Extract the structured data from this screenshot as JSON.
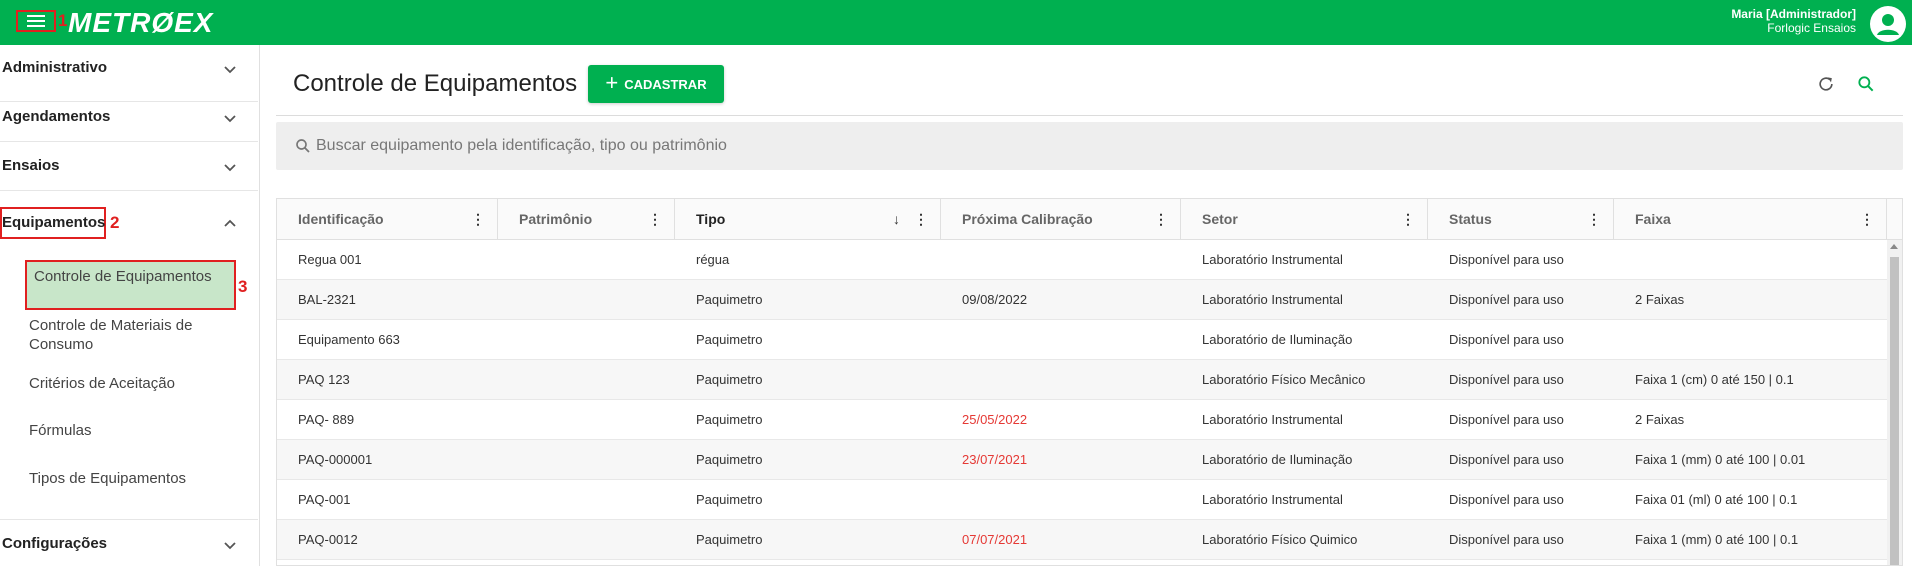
{
  "app": {
    "logo": "METRØEX",
    "user_name": "Maria [Administrador]",
    "user_company": "Forlogic Ensaios"
  },
  "markers": {
    "m1": "1",
    "m2": "2",
    "m3": "3"
  },
  "sidebar": {
    "sections": [
      {
        "label": "Administrativo"
      },
      {
        "label": "Agendamentos"
      },
      {
        "label": "Ensaios"
      },
      {
        "label": "Equipamentos"
      },
      {
        "label": "Configurações"
      }
    ],
    "sub_items": [
      {
        "label": "Controle de Equipamentos"
      },
      {
        "label": "Controle de Materiais de Consumo"
      },
      {
        "label": "Critérios de Aceitação"
      },
      {
        "label": "Fórmulas"
      },
      {
        "label": "Tipos de Equipamentos"
      }
    ]
  },
  "main": {
    "title": "Controle de Equipamentos",
    "add_button": "CADASTRAR",
    "search_placeholder": "Buscar equipamento pela identificação, tipo ou patrimônio"
  },
  "table": {
    "columns": [
      "Identificação",
      "Patrimônio",
      "Tipo",
      "Próxima Calibração",
      "Setor",
      "Status",
      "Faixa"
    ],
    "sort_column": "Tipo",
    "rows": [
      {
        "id": "Regua 001",
        "patrimonio": "",
        "tipo": "régua",
        "calibracao": "",
        "calibracao_overdue": false,
        "setor": "Laboratório Instrumental",
        "status": "Disponível para uso",
        "faixa": ""
      },
      {
        "id": "BAL-2321",
        "patrimonio": "",
        "tipo": "Paquimetro",
        "calibracao": "09/08/2022",
        "calibracao_overdue": false,
        "setor": "Laboratório Instrumental",
        "status": "Disponível para uso",
        "faixa": "2 Faixas"
      },
      {
        "id": "Equipamento 663",
        "patrimonio": "",
        "tipo": "Paquimetro",
        "calibracao": "",
        "calibracao_overdue": false,
        "setor": "Laboratório de Iluminação",
        "status": "Disponível para uso",
        "faixa": ""
      },
      {
        "id": "PAQ 123",
        "patrimonio": "",
        "tipo": "Paquimetro",
        "calibracao": "",
        "calibracao_overdue": false,
        "setor": "Laboratório Físico Mecânico",
        "status": "Disponível para uso",
        "faixa": "Faixa 1 (cm) 0 até 150 | 0.1"
      },
      {
        "id": "PAQ- 889",
        "patrimonio": "",
        "tipo": "Paquimetro",
        "calibracao": "25/05/2022",
        "calibracao_overdue": true,
        "setor": "Laboratório Instrumental",
        "status": "Disponível para uso",
        "faixa": "2 Faixas"
      },
      {
        "id": "PAQ-000001",
        "patrimonio": "",
        "tipo": "Paquimetro",
        "calibracao": "23/07/2021",
        "calibracao_overdue": true,
        "setor": "Laboratório de Iluminação",
        "status": "Disponível para uso",
        "faixa": "Faixa 1 (mm) 0 até 100 | 0.01"
      },
      {
        "id": "PAQ-001",
        "patrimonio": "",
        "tipo": "Paquimetro",
        "calibracao": "",
        "calibracao_overdue": false,
        "setor": "Laboratório Instrumental",
        "status": "Disponível para uso",
        "faixa": "Faixa 01 (ml) 0 até 100 | 0.1"
      },
      {
        "id": "PAQ-0012",
        "patrimonio": "",
        "tipo": "Paquimetro",
        "calibracao": "07/07/2021",
        "calibracao_overdue": true,
        "setor": "Laboratório Físico Quimico",
        "status": "Disponível para uso",
        "faixa": "Faixa 1 (mm) 0 até 100 | 0.1"
      }
    ]
  },
  "colors": {
    "brand": "#00b050",
    "overdue": "#e53935",
    "active_item_bg": "#c8e6c9",
    "annotation": "#e02020"
  }
}
